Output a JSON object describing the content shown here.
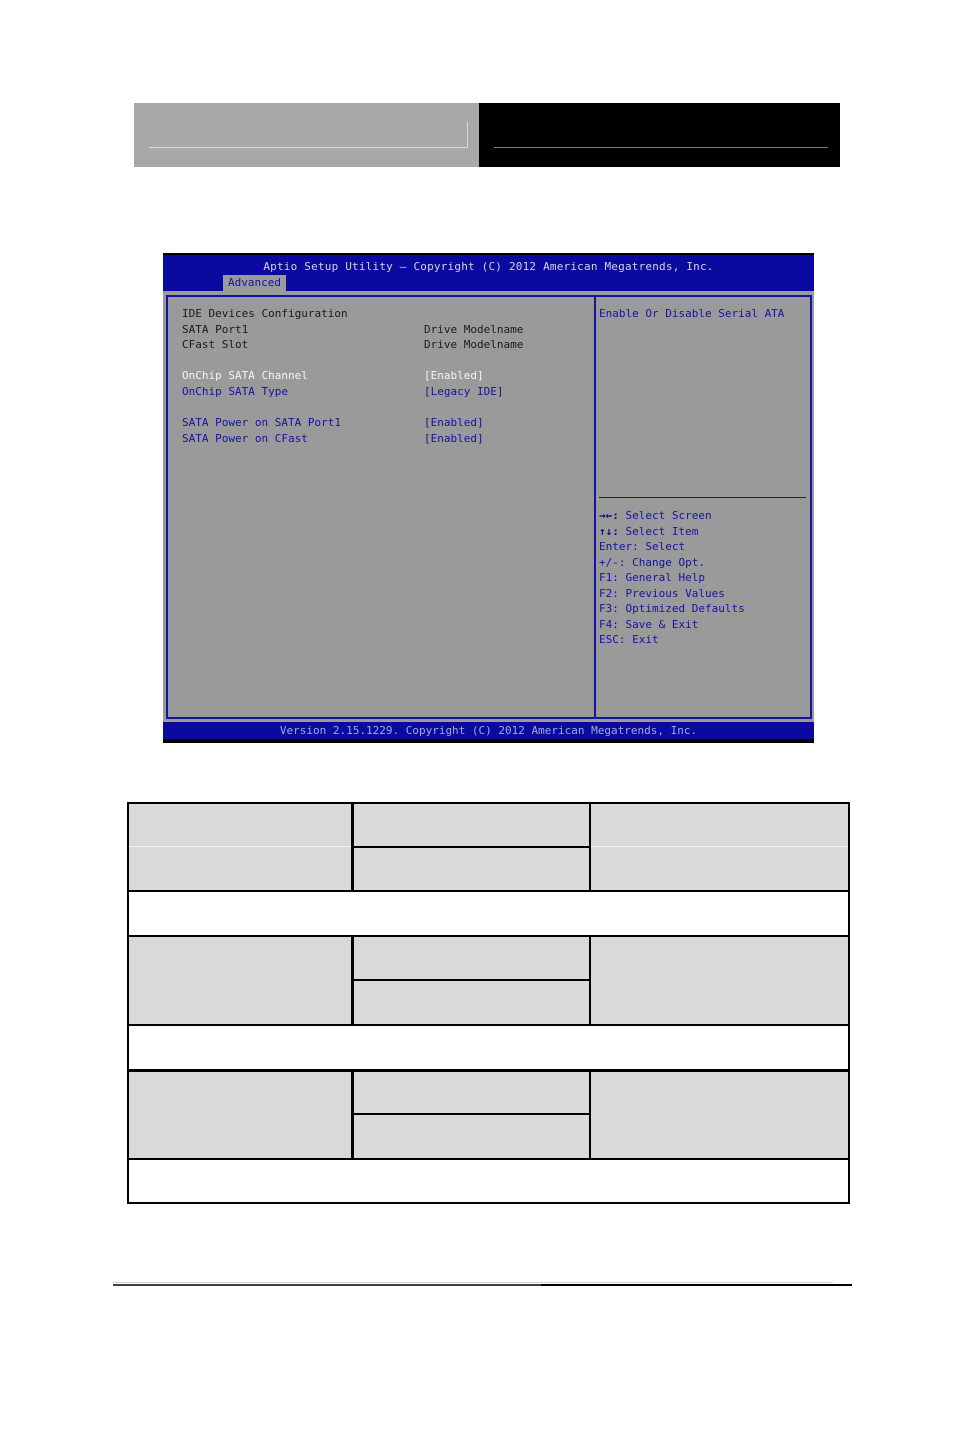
{
  "bios": {
    "title": "Aptio Setup Utility – Copyright (C) 2012 American Megatrends, Inc.",
    "active_tab": "Advanced",
    "footer": "Version 2.15.1229. Copyright (C) 2012 American Megatrends, Inc.",
    "section_title": "IDE Devices Configuration",
    "info_rows": [
      {
        "label": "SATA Port1",
        "value": "Drive Modelname"
      },
      {
        "label": "CFast Slot",
        "value": "Drive Modelname"
      }
    ],
    "settings": [
      {
        "label": "OnChip SATA Channel",
        "value": "[Enabled]",
        "selected": true
      },
      {
        "label": "OnChip SATA Type",
        "value": "[Legacy IDE]",
        "selected": false
      },
      {
        "label": "SATA Power on SATA Port1",
        "value": "[Enabled]",
        "selected": false
      },
      {
        "label": "SATA Power on CFast",
        "value": "[Enabled]",
        "selected": false
      }
    ],
    "help_text": "Enable Or Disable Serial ATA",
    "key_help": [
      {
        "key": "→←:",
        "action": " Select Screen"
      },
      {
        "key": "↑↓:",
        "action": " Select Item"
      },
      {
        "key": "Enter:",
        "action": " Select"
      },
      {
        "key": "+/-:",
        "action": " Change Opt."
      },
      {
        "key": "F1:",
        "action": " General Help"
      },
      {
        "key": "F2:",
        "action": " Previous Values"
      },
      {
        "key": "F3:",
        "action": " Optimized Defaults"
      },
      {
        "key": "F4:",
        "action": " Save & Exit"
      },
      {
        "key": "ESC:",
        "action": " Exit"
      }
    ]
  },
  "colors": {
    "bios_blue": "#0a0aa0",
    "bios_gray": "#9a9a9a",
    "table_gray": "#d9d9d9"
  }
}
